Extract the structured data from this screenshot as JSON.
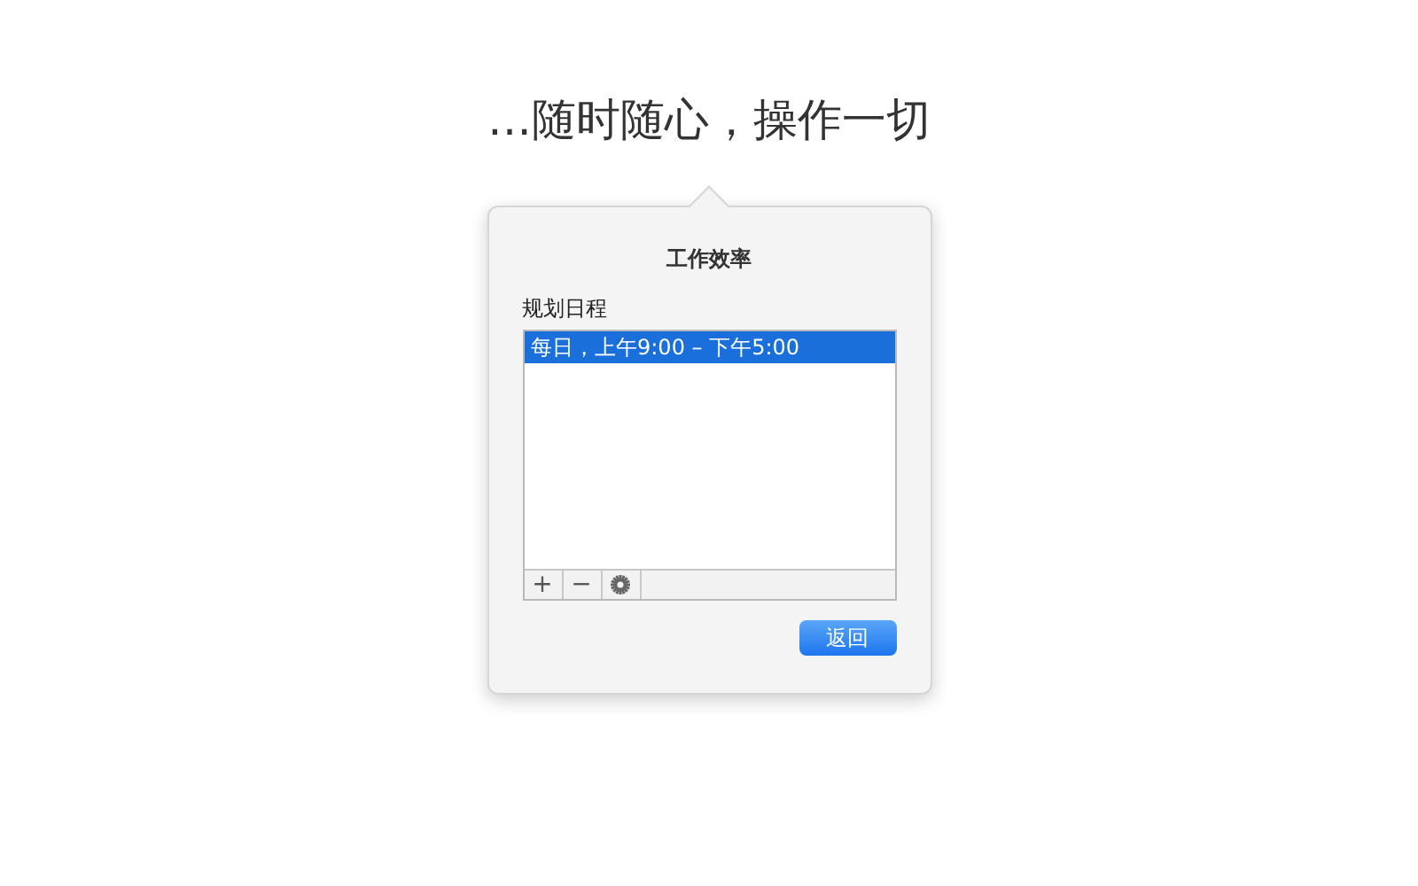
{
  "headline": "…随时随心，操作一切",
  "popover": {
    "title": "工作效率",
    "section_label": "规划日程",
    "schedules": [
      {
        "text": "每日，上午9:00 – 下午5:00",
        "selected": true
      }
    ],
    "toolbar": [
      "+",
      "−"
    ],
    "buttons": [
      "返回"
    ]
  }
}
